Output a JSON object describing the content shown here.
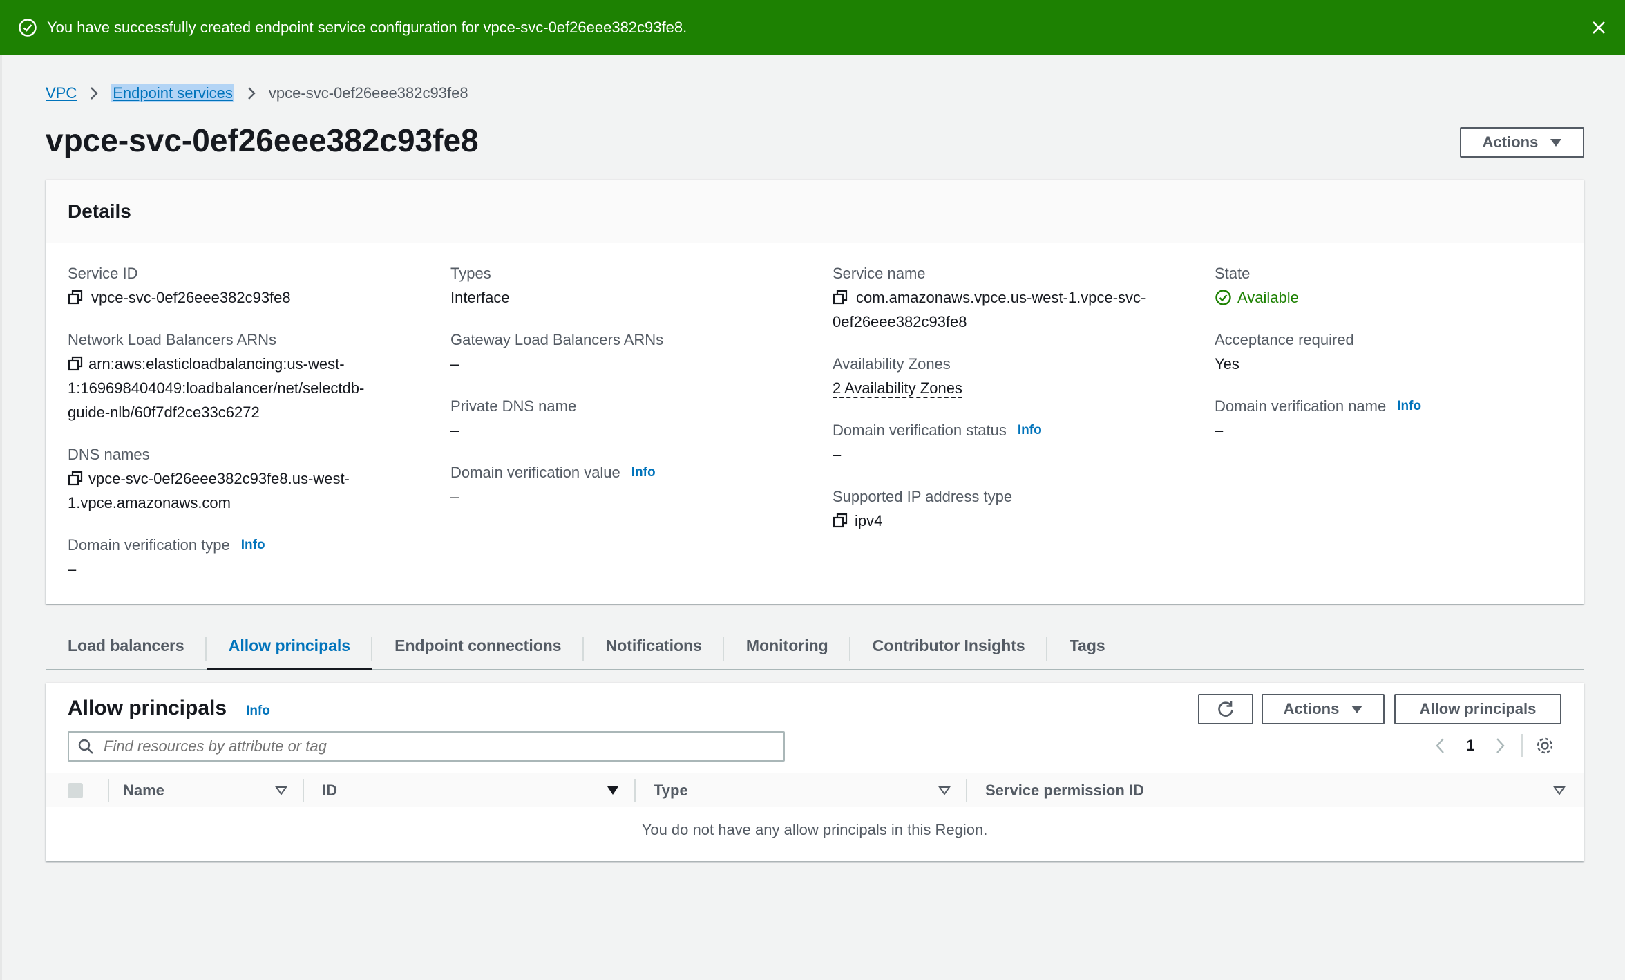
{
  "flash": {
    "message": "You have successfully created endpoint service configuration for vpce-svc-0ef26eee382c93fe8.",
    "color": "#1d8102"
  },
  "breadcrumb": {
    "root": "VPC",
    "parent": "Endpoint services",
    "current": "vpce-svc-0ef26eee382c93fe8"
  },
  "page": {
    "title": "vpce-svc-0ef26eee382c93fe8",
    "actions_label": "Actions"
  },
  "details": {
    "title": "Details",
    "service_id_label": "Service ID",
    "service_id": "vpce-svc-0ef26eee382c93fe8",
    "nlb_arns_label": "Network Load Balancers ARNs",
    "nlb_arns_line1": "arn:aws:elasticloadbalancing:us-west-",
    "nlb_arns_line2": "1:169698404049:loadbalancer/net/selectdb-",
    "nlb_arns_line3": "guide-nlb/60f7df2ce33c6272",
    "dns_names_label": "DNS names",
    "dns_names_line1": "vpce-svc-0ef26eee382c93fe8.us-west-",
    "dns_names_line2": "1.vpce.amazonaws.com",
    "domain_verification_type_label": "Domain verification type",
    "domain_verification_type": "–",
    "types_label": "Types",
    "types": "Interface",
    "gwlb_arns_label": "Gateway Load Balancers ARNs",
    "gwlb_arns": "–",
    "private_dns_label": "Private DNS name",
    "private_dns": "–",
    "domain_verification_value_label": "Domain verification value",
    "domain_verification_value": "–",
    "service_name_label": "Service name",
    "service_name_line1": "com.amazonaws.vpce.us-west-1.vpce-svc-",
    "service_name_line2": "0ef26eee382c93fe8",
    "az_label": "Availability Zones",
    "az": "2 Availability Zones",
    "domain_verification_status_label": "Domain verification status",
    "domain_verification_status": "–",
    "ip_type_label": "Supported IP address type",
    "ip_type": "ipv4",
    "state_label": "State",
    "state": "Available",
    "acceptance_label": "Acceptance required",
    "acceptance": "Yes",
    "domain_verification_name_label": "Domain verification name",
    "domain_verification_name": "–",
    "info": "Info"
  },
  "tabs": [
    {
      "label": "Load balancers"
    },
    {
      "label": "Allow principals"
    },
    {
      "label": "Endpoint connections"
    },
    {
      "label": "Notifications"
    },
    {
      "label": "Monitoring"
    },
    {
      "label": "Contributor Insights"
    },
    {
      "label": "Tags"
    }
  ],
  "principals": {
    "title": "Allow principals",
    "info": "Info",
    "actions_label": "Actions",
    "allow_button": "Allow principals",
    "search_placeholder": "Find resources by attribute or tag",
    "page_number": "1",
    "columns": [
      "Name",
      "ID",
      "Type",
      "Service permission ID"
    ],
    "empty_message": "You do not have any allow principals in this Region."
  }
}
